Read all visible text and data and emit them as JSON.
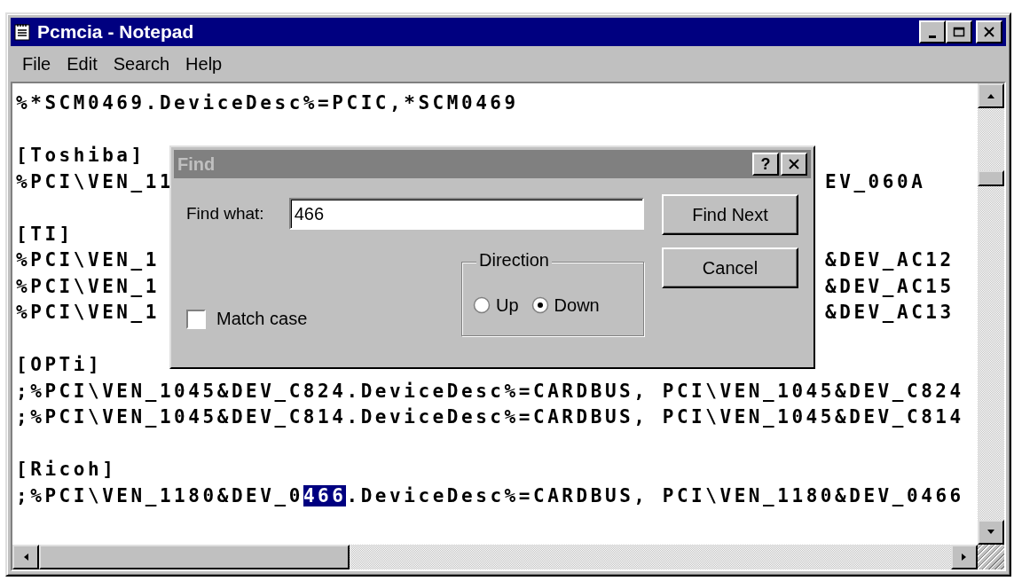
{
  "window": {
    "title": "Pcmcia - Notepad"
  },
  "menu": [
    {
      "label": "File"
    },
    {
      "label": "Edit"
    },
    {
      "label": "Search"
    },
    {
      "label": "Help"
    }
  ],
  "blocks": [
    {
      "lines": [
        {
          "text": "%*SCM0469.DeviceDesc%=PCIC,*SCM0469"
        }
      ]
    },
    {
      "lines": [
        {
          "text": "[Toshiba]"
        },
        {
          "text": "%PCI\\VEN_11",
          "right": "EV_060A"
        }
      ]
    },
    {
      "lines": [
        {
          "text": "[TI]"
        },
        {
          "text": "%PCI\\VEN_1",
          "right": "&DEV_AC12"
        },
        {
          "text": "%PCI\\VEN_1",
          "right": "&DEV_AC15"
        },
        {
          "text": "%PCI\\VEN_1",
          "right": "&DEV_AC13"
        }
      ]
    },
    {
      "lines": [
        {
          "text": "[OPTi]"
        },
        {
          "text": ";%PCI\\VEN_1045&DEV_C824.DeviceDesc%=CARDBUS, PCI\\VEN_1045&DEV_C824"
        },
        {
          "text": ";%PCI\\VEN_1045&DEV_C814.DeviceDesc%=CARDBUS, PCI\\VEN_1045&DEV_C814"
        }
      ]
    },
    {
      "lines": [
        {
          "text": "[Ricoh]"
        },
        {
          "segments": [
            {
              "text": ";%PCI\\VEN_1180&DEV_0",
              "selected": false
            },
            {
              "text": "466",
              "selected": true
            },
            {
              "text": ".DeviceDesc%=CARDBUS, PCI\\VEN_1180&DEV_0466",
              "selected": false
            }
          ]
        }
      ]
    }
  ],
  "dialog": {
    "title": "Find",
    "help_button": "?",
    "find_what": {
      "label": "Find what:",
      "value": "466"
    },
    "match_case": {
      "label": "Match case",
      "checked": false
    },
    "direction": {
      "label": "Direction",
      "options": [
        {
          "label": "Up",
          "selected": false
        },
        {
          "label": "Down",
          "selected": true
        }
      ]
    },
    "buttons": [
      {
        "label": "Find Next"
      },
      {
        "label": "Cancel"
      }
    ]
  }
}
